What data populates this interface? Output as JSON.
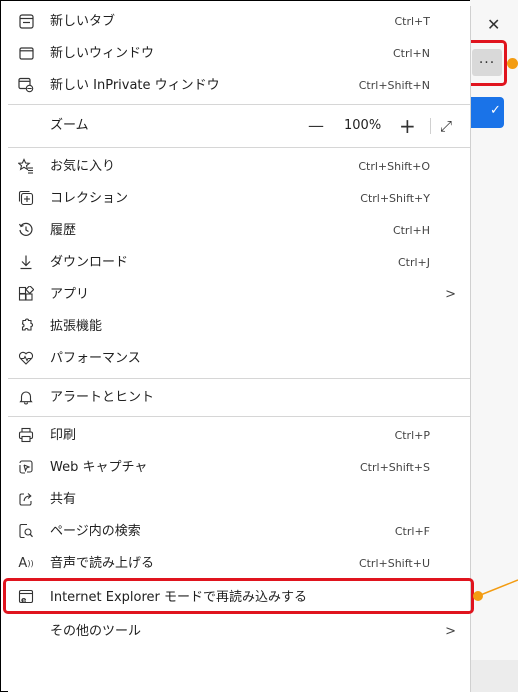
{
  "window": {
    "close_glyph": "✕",
    "more_glyph": "···"
  },
  "colors": {
    "highlight_red": "#e0141e",
    "callout_orange": "#f39c12",
    "accent_blue": "#1a73e8"
  },
  "menu": {
    "new_tab": {
      "label": "新しいタブ",
      "shortcut": "Ctrl+T",
      "icon": "new-tab-icon"
    },
    "new_window": {
      "label": "新しいウィンドウ",
      "shortcut": "Ctrl+N",
      "icon": "new-window-icon"
    },
    "new_inprivate": {
      "label": "新しい InPrivate ウィンドウ",
      "shortcut": "Ctrl+Shift+N",
      "icon": "inprivate-icon"
    },
    "zoom": {
      "label": "ズーム",
      "minus": "—",
      "value": "100%",
      "plus": "+",
      "fullscreen": "⤢"
    },
    "favorites": {
      "label": "お気に入り",
      "shortcut": "Ctrl+Shift+O",
      "icon": "favorites-icon"
    },
    "collections": {
      "label": "コレクション",
      "shortcut": "Ctrl+Shift+Y",
      "icon": "collections-icon"
    },
    "history": {
      "label": "履歴",
      "shortcut": "Ctrl+H",
      "icon": "history-icon"
    },
    "downloads": {
      "label": "ダウンロード",
      "shortcut": "Ctrl+J",
      "icon": "download-icon"
    },
    "apps": {
      "label": "アプリ",
      "chevron": ">",
      "icon": "apps-icon"
    },
    "extensions": {
      "label": "拡張機能",
      "icon": "extensions-icon"
    },
    "performance": {
      "label": "パフォーマンス",
      "icon": "performance-icon"
    },
    "alerts": {
      "label": "アラートとヒント",
      "icon": "bell-icon"
    },
    "print": {
      "label": "印刷",
      "shortcut": "Ctrl+P",
      "icon": "print-icon"
    },
    "web_capture": {
      "label": "Web キャプチャ",
      "shortcut": "Ctrl+Shift+S",
      "icon": "web-capture-icon"
    },
    "share": {
      "label": "共有",
      "icon": "share-icon"
    },
    "find": {
      "label": "ページ内の検索",
      "shortcut": "Ctrl+F",
      "icon": "find-icon"
    },
    "read_aloud": {
      "label": "音声で読み上げる",
      "shortcut": "Ctrl+Shift+U",
      "icon": "read-aloud-icon"
    },
    "ie_mode": {
      "label": "Internet Explorer モードで再読み込みする",
      "icon": "ie-mode-icon"
    },
    "more_tools": {
      "label": "その他のツール",
      "chevron": ">"
    }
  }
}
